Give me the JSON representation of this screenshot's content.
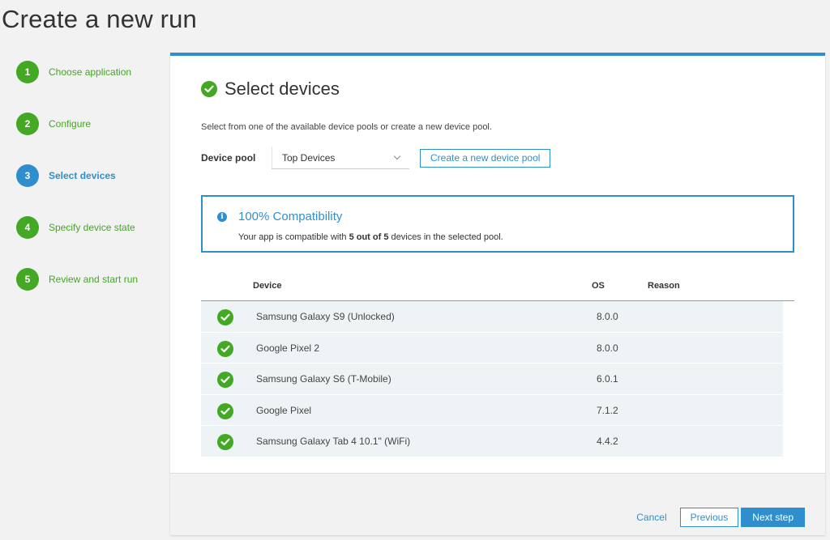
{
  "page": {
    "title": "Create a new run"
  },
  "wizard_steps": [
    {
      "num": "1",
      "label": "Choose application",
      "state": "done"
    },
    {
      "num": "2",
      "label": "Configure",
      "state": "done"
    },
    {
      "num": "3",
      "label": "Select devices",
      "state": "current"
    },
    {
      "num": "4",
      "label": "Specify device state",
      "state": "done"
    },
    {
      "num": "5",
      "label": "Review and start run",
      "state": "done"
    }
  ],
  "section": {
    "title": "Select devices",
    "intro": "Select from one of the available device pools or create a new device pool."
  },
  "device_pool": {
    "label": "Device pool",
    "selected": "Top Devices",
    "new_button": "Create a new device pool"
  },
  "compatibility": {
    "title": "100% Compatibility",
    "text_before": "Your app is compatible with ",
    "text_bold": "5 out of 5",
    "text_after": " devices in the selected pool."
  },
  "device_table": {
    "columns": {
      "device": "Device",
      "os": "OS",
      "reason": "Reason"
    },
    "rows": [
      {
        "device": "Samsung Galaxy S9 (Unlocked)",
        "os": "8.0.0",
        "reason": ""
      },
      {
        "device": "Google Pixel 2",
        "os": "8.0.0",
        "reason": ""
      },
      {
        "device": "Samsung Galaxy S6 (T-Mobile)",
        "os": "6.0.1",
        "reason": ""
      },
      {
        "device": "Google Pixel",
        "os": "7.1.2",
        "reason": ""
      },
      {
        "device": "Samsung Galaxy Tab 4 10.1\" (WiFi)",
        "os": "4.4.2",
        "reason": ""
      }
    ]
  },
  "footer": {
    "cancel": "Cancel",
    "previous": "Previous",
    "next": "Next step"
  },
  "colors": {
    "accent": "#2f8fce",
    "success": "#43a823"
  }
}
